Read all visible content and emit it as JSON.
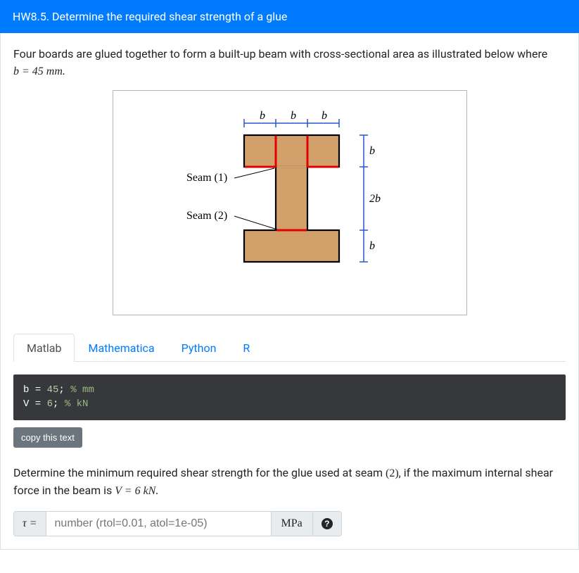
{
  "header": {
    "title": "HW8.5. Determine the required shear strength of a glue"
  },
  "prompt": {
    "line1": "Four boards are glued together to form a built-up beam with cross-sectional area as illustrated below where",
    "math_expr": "b = 45 mm."
  },
  "figure": {
    "seam1_label": "Seam (1)",
    "seam2_label": "Seam (2)",
    "dim_b": "b",
    "dim_2b": "2b"
  },
  "tabs": [
    {
      "label": "Matlab",
      "active": true
    },
    {
      "label": "Mathematica",
      "active": false
    },
    {
      "label": "Python",
      "active": false
    },
    {
      "label": "R",
      "active": false
    }
  ],
  "code": {
    "line1_a": "b = ",
    "line1_b": "45",
    "line1_c": "; ",
    "line1_d": "% mm",
    "line2_a": "V = ",
    "line2_b": "6",
    "line2_c": "; ",
    "line2_d": "% kN"
  },
  "copy_btn": "copy this text",
  "question": {
    "part1": "Determine the minimum required shear strength for the glue used at seam ",
    "seam_num": "(2)",
    "part2": ", if the maximum internal shear force in the beam is ",
    "force_expr": "V = 6 kN."
  },
  "answer": {
    "symbol": "τ =",
    "placeholder": "number (rtol=0.01, atol=1e-05)",
    "unit": "MPa"
  },
  "chart_data": {
    "type": "diagram",
    "description": "I-beam cross section built from 4 glued boards",
    "parameter_b_mm": 45,
    "top_flange": {
      "width": "3b",
      "height": "b"
    },
    "web": {
      "width": "b",
      "height": "2b"
    },
    "bottom_flange": {
      "width": "3b",
      "height": "b"
    },
    "seams": [
      {
        "id": 1,
        "location": "interface between top flange and web (left and right of web)"
      },
      {
        "id": 2,
        "location": "interface between web and bottom flange"
      }
    ],
    "top_width_labels": [
      "b",
      "b",
      "b"
    ],
    "right_height_labels": [
      "b",
      "2b",
      "b"
    ],
    "shear_force_V_kN": 6
  }
}
